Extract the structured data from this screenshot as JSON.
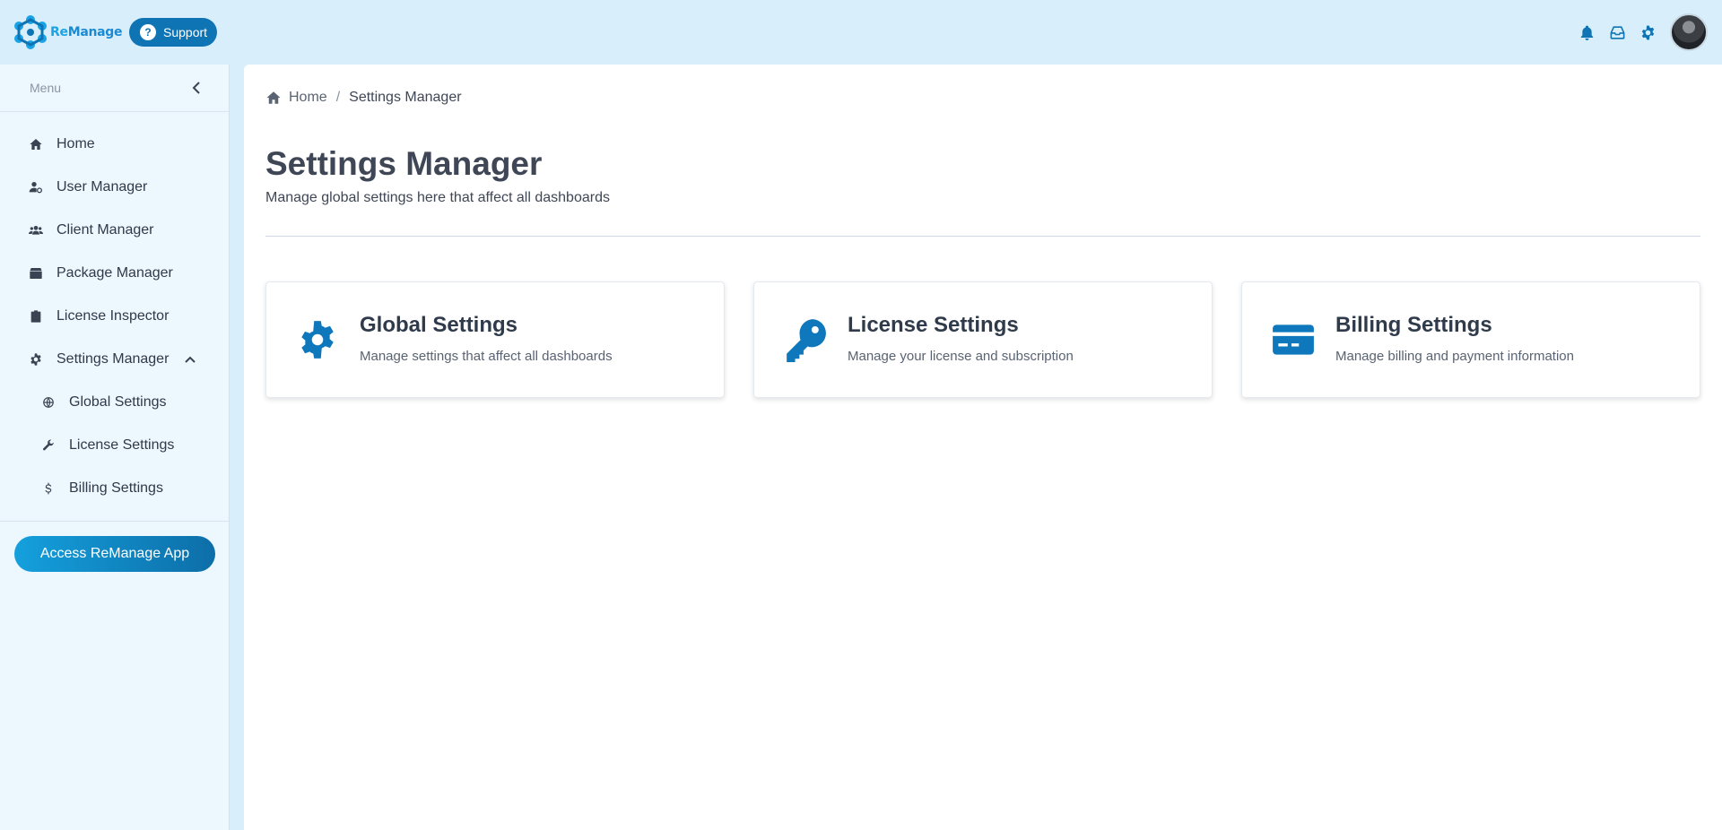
{
  "app": {
    "brand_prefix": "Re",
    "brand_suffix": "Manage",
    "support_label": "Support",
    "accent": "#0f74b3"
  },
  "topbar": {
    "icons": [
      "bell-icon",
      "inbox-icon",
      "gear-icon"
    ]
  },
  "sidebar": {
    "menu_label": "Menu",
    "items": [
      {
        "label": "Home",
        "icon": "home-icon"
      },
      {
        "label": "User Manager",
        "icon": "user-cog-icon"
      },
      {
        "label": "Client Manager",
        "icon": "users-icon"
      },
      {
        "label": "Package Manager",
        "icon": "box-icon"
      },
      {
        "label": "License Inspector",
        "icon": "clipboard-icon"
      },
      {
        "label": "Settings Manager",
        "icon": "gear-icon",
        "expanded": true
      }
    ],
    "sub_items": [
      {
        "label": "Global Settings",
        "icon": "globe-icon"
      },
      {
        "label": "License Settings",
        "icon": "wrench-icon"
      },
      {
        "label": "Billing Settings",
        "icon": "dollar-icon"
      }
    ],
    "access_button": "Access ReManage App"
  },
  "breadcrumb": {
    "home": "Home",
    "separator": "/",
    "current": "Settings Manager"
  },
  "page": {
    "title": "Settings Manager",
    "subtitle": "Manage global settings here that affect all dashboards"
  },
  "cards": [
    {
      "title": "Global Settings",
      "desc": "Manage settings that affect all dashboards",
      "icon": "gear-icon"
    },
    {
      "title": "License Settings",
      "desc": "Manage your license and subscription",
      "icon": "key-icon"
    },
    {
      "title": "Billing Settings",
      "desc": "Manage billing and payment information",
      "icon": "credit-card-icon"
    }
  ]
}
